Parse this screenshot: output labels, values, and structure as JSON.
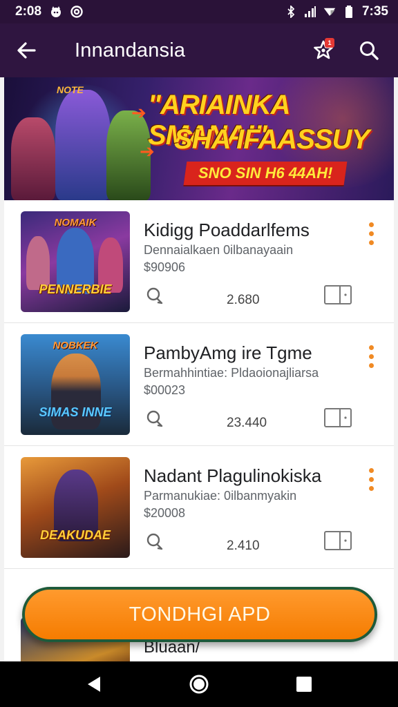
{
  "status_bar": {
    "time_left": "2:08",
    "time_right": "7:35",
    "icons": [
      "cat-icon",
      "at-icon",
      "bluetooth-icon",
      "signal-icon",
      "wifi-icon",
      "battery-icon"
    ]
  },
  "app_bar": {
    "title": "Innandansia",
    "icons": [
      "back-arrow-icon",
      "star-badge-icon",
      "search-icon"
    ],
    "badge_text": "1"
  },
  "banner": {
    "small_text": "NOTE",
    "headline_line1": "\"ARIAINKA SMANA!\"",
    "headline_line2": "SHA IFAASSUY",
    "ribbon_text": "SNO SIN H6 44AH!",
    "colors": {
      "headline": "#ffd21f",
      "ribbon": "#d9241c"
    }
  },
  "games": [
    {
      "title": "Kidigg Poaddarlfems",
      "subtitle": "Dennaialkaen 0ilbanayaain",
      "price": "$90906",
      "count": "2.680",
      "thumb_top": "NOMAIK",
      "thumb_label": "PENNERBIE"
    },
    {
      "title": "PambyAmg ire Tgme",
      "subtitle": "Bermahhintiae: Pldaoionajliarsa",
      "price": "$00023",
      "count": "23.440",
      "thumb_top": "NOBKEK",
      "thumb_label": "SIMAS INNE"
    },
    {
      "title": "Nadant Plagulinokiska",
      "subtitle": "Parmanukiae: 0ilbanmyakin",
      "price": "$20008",
      "count": "2.410",
      "thumb_top": "",
      "thumb_label": "DEAKUDAE"
    }
  ],
  "partial_item": {
    "title": "Bluaan/"
  },
  "cta": {
    "label": "TONDHGI APD",
    "color": "#f57c00"
  },
  "nav_bar": {
    "icons": [
      "back-triangle-icon",
      "home-circle-icon",
      "recents-square-icon"
    ]
  }
}
